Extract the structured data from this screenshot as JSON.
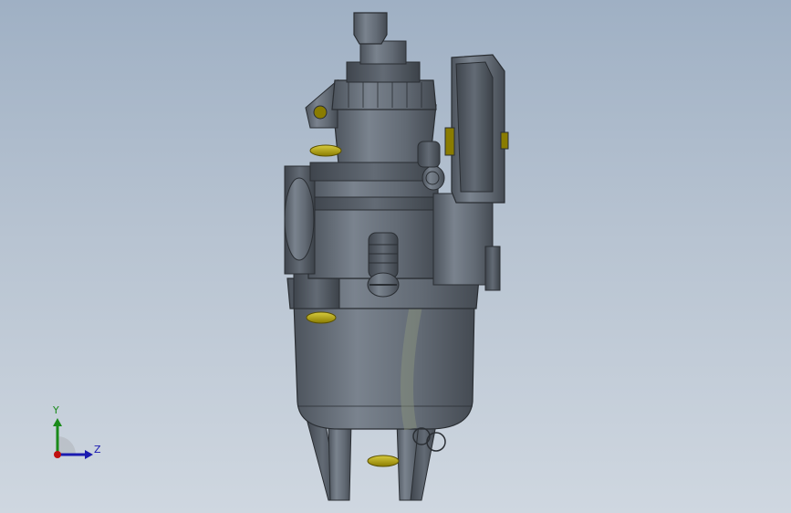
{
  "viewport": {
    "background_top": "#9fb0c4",
    "background_bottom": "#cfd7e0"
  },
  "model": {
    "name": "carburetor-3d-model",
    "body_color": "#6a727d",
    "accent_color": "#b8a400"
  },
  "triad": {
    "y_label": "Y",
    "z_label": "Z",
    "y_color": "#1a8a1a",
    "z_color": "#1a1ab0",
    "x_color": "#c01010",
    "icon": "coordinate-triad-icon"
  }
}
